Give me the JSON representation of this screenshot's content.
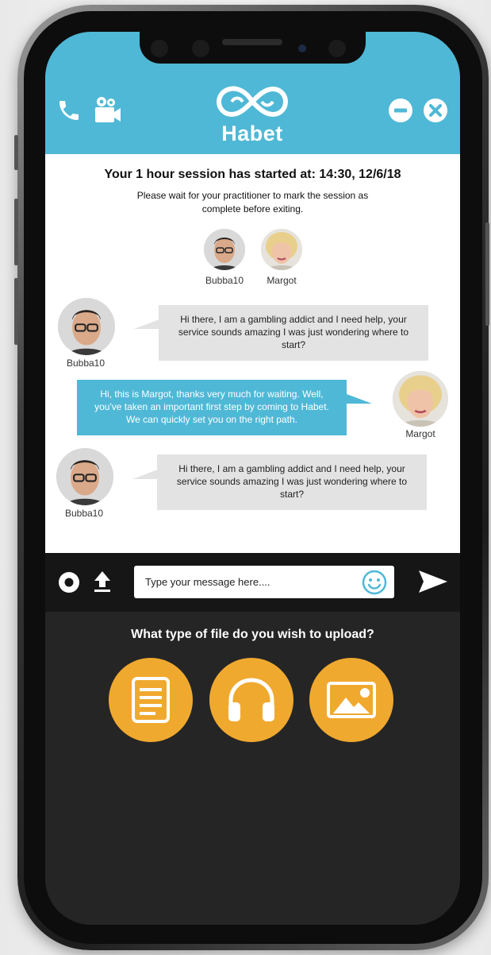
{
  "header": {
    "brand": "Habet",
    "left_icons": [
      "phone-icon",
      "video-camera-icon"
    ],
    "right_icons": [
      "minimize-icon",
      "close-icon"
    ]
  },
  "session": {
    "title": "Your 1 hour session has started at: 14:30, 12/6/18",
    "subtitle": "Please wait for your practitioner to mark the session as complete before exiting."
  },
  "participants": [
    {
      "name": "Bubba10"
    },
    {
      "name": "Margot"
    }
  ],
  "messages": [
    {
      "sender": "Bubba10",
      "side": "left",
      "text": "Hi there, I am a gambling addict and I need help, your service sounds amazing I was just wondering where to start?"
    },
    {
      "sender": "Margot",
      "side": "right",
      "text": "Hi, this is Margot, thanks very much for waiting. Well, you've taken an important first step by coming to Habet. We can quickly set you on the right path."
    },
    {
      "sender": "Bubba10",
      "side": "left",
      "text": "Hi there, I am a gambling addict and I need help, your service sounds amazing I was just wondering where to start?"
    }
  ],
  "input": {
    "placeholder": "Type your message here....",
    "value": ""
  },
  "upload": {
    "title": "What type of file do you wish to upload?",
    "options": [
      "document-icon",
      "headphones-icon",
      "image-icon"
    ]
  },
  "colors": {
    "header": "#4fb8d6",
    "accent": "#f0a92f",
    "bubble_grey": "#e3e3e3",
    "panel": "#252525"
  }
}
